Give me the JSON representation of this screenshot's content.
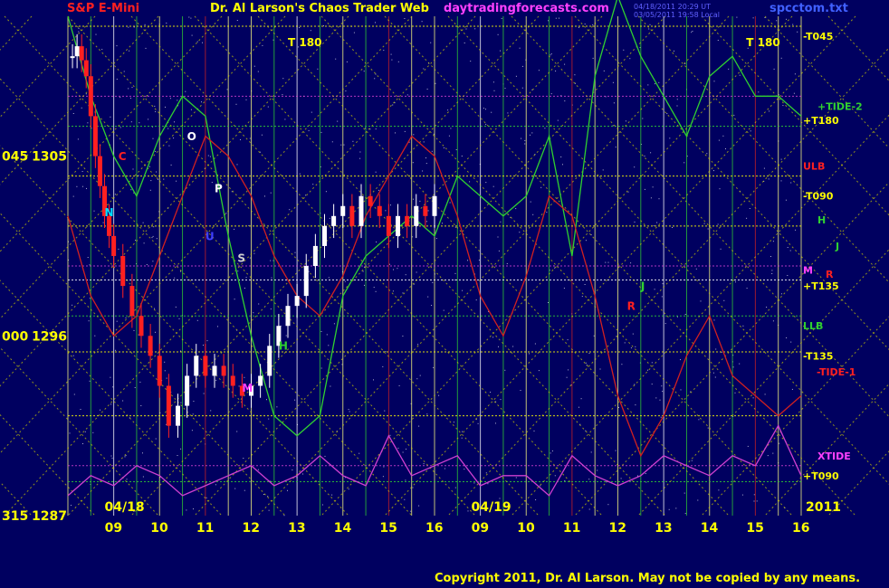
{
  "header": {
    "left_title": "S&P E-Mini",
    "center_title": "Dr. Al Larson's Chaos Trader Web",
    "site": "daytradingforecasts.com",
    "timestamp_1": "04/18/2011 20:29 UT",
    "timestamp_2": "03/05/2011 19:58 Local",
    "file": "spcctom.txt"
  },
  "footer": {
    "copyright": "Copyright 2011, Dr. Al Larson. May not be copied by any means."
  },
  "colors": {
    "background": "#000060",
    "price_up": "#ffffff",
    "price_down": "#ff2020",
    "field_green": "#30d030",
    "field_red": "#d02020",
    "field_magenta": "#d040d0",
    "grid_yellow": "#d0d000",
    "text_yellow": "#ffff00"
  },
  "chart_data": {
    "type": "line",
    "title": "S&P E-Mini",
    "y_axis_left": [
      {
        "angle": "045",
        "price": "1305"
      },
      {
        "angle": "000",
        "price": "1296"
      },
      {
        "angle": "315",
        "price": "1287"
      }
    ],
    "ylim": [
      1287,
      1312
    ],
    "x_tick_labels": [
      "09",
      "10",
      "11",
      "12",
      "13",
      "14",
      "15",
      "16",
      "09",
      "10",
      "11",
      "12",
      "13",
      "14",
      "15",
      "16"
    ],
    "date_labels": [
      "04/18",
      "04/19"
    ],
    "year_label": "2011",
    "right_labels": [
      {
        "text": "-T045",
        "color": "#ffff00"
      },
      {
        "text": "+TIDE-2",
        "color": "#30d030"
      },
      {
        "text": "+T180",
        "color": "#ffff00"
      },
      {
        "text": "ULB",
        "color": "#ff2020"
      },
      {
        "text": "-T090",
        "color": "#ffff00"
      },
      {
        "text": "H",
        "color": "#30d030"
      },
      {
        "text": "J",
        "color": "#30d030"
      },
      {
        "text": "M",
        "color": "#ff40ff"
      },
      {
        "text": "R",
        "color": "#ff2020"
      },
      {
        "text": "+T135",
        "color": "#ffff00"
      },
      {
        "text": "LLB",
        "color": "#30d030"
      },
      {
        "text": "-T135",
        "color": "#ffff00"
      },
      {
        "text": "-TIDE-1",
        "color": "#ff2020"
      },
      {
        "text": "XTIDE",
        "color": "#ff40ff"
      },
      {
        "text": "+T090",
        "color": "#ffff00"
      }
    ],
    "chart_annotations": [
      {
        "text": "T 180",
        "color": "#ffff00"
      },
      {
        "text": "T 180",
        "color": "#ffff00"
      },
      {
        "text": "O",
        "color": "#ffffff"
      },
      {
        "text": "P",
        "color": "#ffffff"
      },
      {
        "text": "C",
        "color": "#ff2020"
      },
      {
        "text": "N",
        "color": "#00e0ff"
      },
      {
        "text": "S",
        "color": "#d0d0d0"
      },
      {
        "text": "H",
        "color": "#30d030"
      },
      {
        "text": "M",
        "color": "#ff40ff"
      },
      {
        "text": "R",
        "color": "#ff2020"
      },
      {
        "text": "J",
        "color": "#30d030"
      },
      {
        "text": "U",
        "color": "#4040ff"
      }
    ],
    "series": [
      {
        "name": "S&P E-Mini price",
        "type": "candlestick",
        "x": [
          0.1,
          0.2,
          0.3,
          0.4,
          0.5,
          0.6,
          0.7,
          0.8,
          0.9,
          1.0,
          1.2,
          1.4,
          1.6,
          1.8,
          2.0,
          2.2,
          2.4,
          2.6,
          2.8,
          3.0,
          3.2,
          3.4,
          3.6,
          3.8,
          4.0,
          4.2,
          4.4,
          4.6,
          4.8,
          5.0,
          5.2,
          5.4,
          5.6,
          5.8,
          6.0,
          6.2,
          6.4,
          6.6,
          6.8,
          7.0,
          7.2,
          7.4,
          7.6,
          7.8,
          8.0
        ],
        "close": [
          1310,
          1310.5,
          1309.8,
          1309,
          1307,
          1305,
          1303.5,
          1302,
          1301,
          1300,
          1298.5,
          1297,
          1296,
          1295,
          1293.5,
          1291.5,
          1292.5,
          1294,
          1295,
          1294,
          1294.5,
          1294,
          1293.5,
          1293,
          1293.5,
          1294,
          1295.5,
          1296.5,
          1297.5,
          1298,
          1299.5,
          1300.5,
          1301.5,
          1302,
          1302.5,
          1301.5,
          1303,
          1302.5,
          1302,
          1301,
          1302,
          1301.5,
          1302.5,
          1302,
          1303
        ]
      },
      {
        "name": "field line green",
        "x": [
          0,
          0.5,
          1,
          1.5,
          2,
          2.5,
          3,
          3.5,
          4,
          4.5,
          5,
          5.5,
          6,
          6.5,
          7,
          7.5,
          8,
          8.5,
          9,
          9.5,
          10,
          10.5,
          11,
          11.5,
          12,
          12.5,
          13,
          13.5,
          14,
          14.5,
          15,
          15.5,
          16
        ],
        "y": [
          1312,
          1308,
          1305,
          1303,
          1306,
          1308,
          1307,
          1301,
          1296,
          1292,
          1291,
          1292,
          1298,
          1300,
          1301,
          1302,
          1301,
          1304,
          1303,
          1302,
          1303,
          1306,
          1300,
          1309,
          1313,
          1310,
          1308,
          1306,
          1309,
          1310,
          1308,
          1308,
          1307
        ]
      },
      {
        "name": "field line red",
        "x": [
          0,
          0.5,
          1,
          1.5,
          2,
          2.5,
          3,
          3.5,
          4,
          4.5,
          5,
          5.5,
          6,
          6.5,
          7,
          7.5,
          8,
          8.5,
          9,
          9.5,
          10,
          10.5,
          11,
          11.5,
          12,
          12.5,
          13,
          13.5,
          14,
          14.5,
          15,
          15.5,
          16
        ],
        "y": [
          1302,
          1298,
          1296,
          1297,
          1300,
          1303,
          1306,
          1305,
          1303,
          1300,
          1298,
          1297,
          1299,
          1302,
          1304,
          1306,
          1305,
          1302,
          1298,
          1296,
          1299,
          1303,
          1302,
          1298,
          1293,
          1290,
          1292,
          1295,
          1297,
          1294,
          1293,
          1292,
          1293
        ]
      },
      {
        "name": "field line magenta",
        "x": [
          0,
          0.5,
          1,
          1.5,
          2,
          2.5,
          3,
          3.5,
          4,
          4.5,
          5,
          5.5,
          6,
          6.5,
          7,
          7.5,
          8,
          8.5,
          9,
          9.5,
          10,
          10.5,
          11,
          11.5,
          12,
          12.5,
          13,
          13.5,
          14,
          14.5,
          15,
          15.5,
          16
        ],
        "y": [
          1288,
          1289,
          1288.5,
          1289.5,
          1289,
          1288,
          1288.5,
          1289,
          1289.5,
          1288.5,
          1289,
          1290,
          1289,
          1288.5,
          1291,
          1289,
          1289.5,
          1290,
          1288.5,
          1289,
          1289,
          1288,
          1290,
          1289,
          1288.5,
          1289,
          1290,
          1289.5,
          1289,
          1290,
          1289.5,
          1291.5,
          1289
        ]
      }
    ]
  }
}
